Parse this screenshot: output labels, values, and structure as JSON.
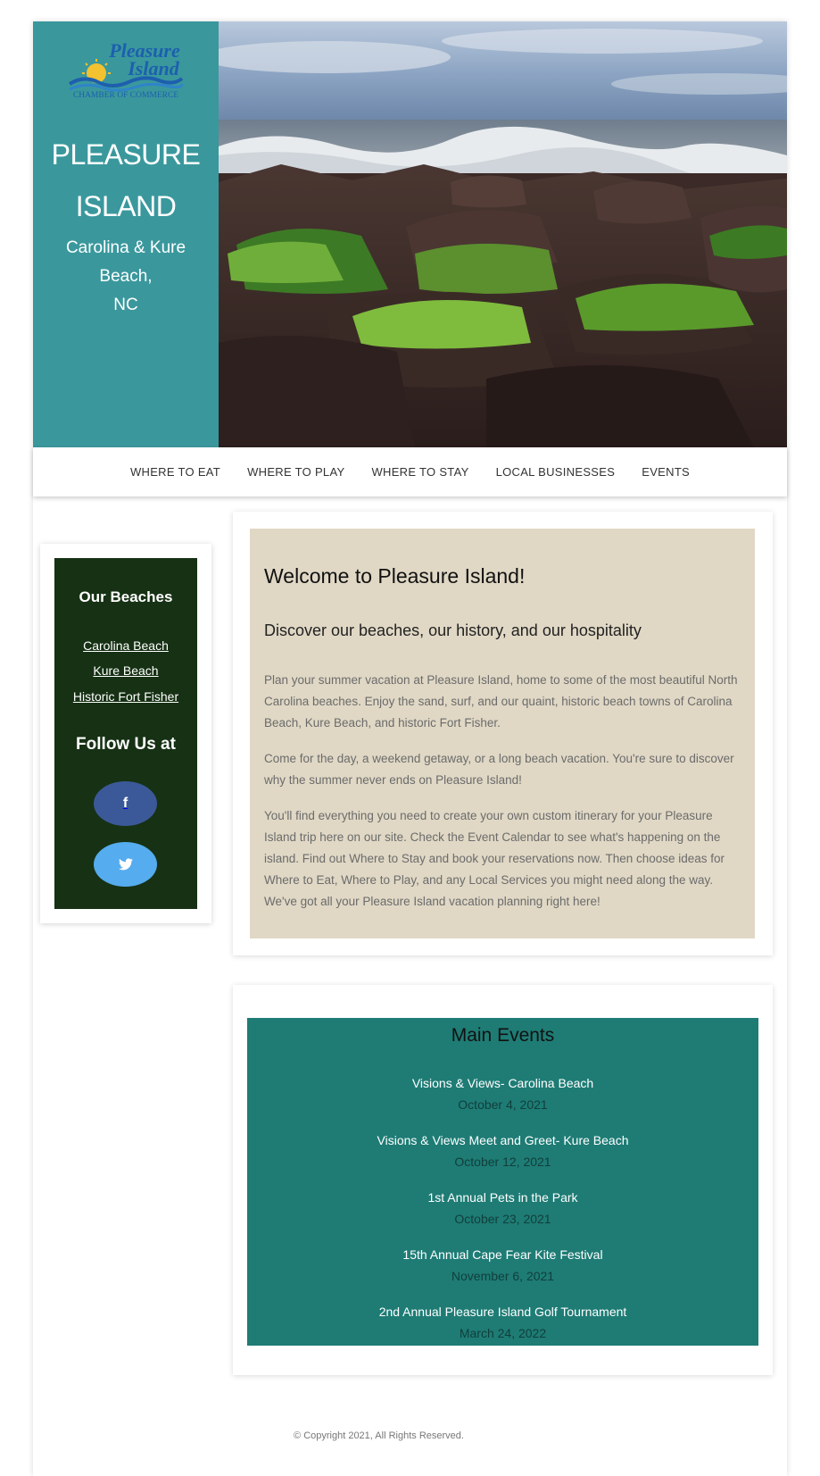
{
  "brand": {
    "logo_text_line1": "Pleasure",
    "logo_text_line2": "Island",
    "logo_tagline": "CHAMBER OF COMMERCE",
    "title_line1": "PLEASURE",
    "title_line2": "ISLAND",
    "subtitle_line1": "Carolina & Kure Beach,",
    "subtitle_line2": "NC",
    "color": "#3a989d"
  },
  "nav": {
    "items": [
      {
        "label": "WHERE TO EAT"
      },
      {
        "label": "WHERE TO PLAY"
      },
      {
        "label": "WHERE TO STAY"
      },
      {
        "label": "LOCAL BUSINESSES"
      },
      {
        "label": "EVENTS"
      }
    ]
  },
  "sidebar": {
    "beaches_heading": "Our Beaches",
    "links": [
      {
        "label": "Carolina Beach"
      },
      {
        "label": "Kure Beach"
      },
      {
        "label": "Historic Fort Fisher"
      }
    ],
    "follow_heading": "Follow Us at",
    "social": [
      {
        "icon": "facebook-icon",
        "glyph": "f",
        "color": "#3b5998"
      },
      {
        "icon": "twitter-icon",
        "color": "#55acee"
      }
    ],
    "bg_color": "#163114"
  },
  "welcome": {
    "title": "Welcome to Pleasure Island!",
    "subtitle": "Discover our beaches, our history, and our hospitality",
    "paragraphs": [
      "Plan your summer vacation at Pleasure Island, home to some of the most beautiful North Carolina beaches. Enjoy the sand, surf, and our quaint, historic beach towns of Carolina Beach, Kure Beach, and historic Fort Fisher.",
      "Come for the day, a weekend getaway, or a long beach vacation. You're sure to discover why the summer never ends on Pleasure Island!",
      "You'll find everything you need to create your own custom itinerary for your Pleasure Island trip here on our site. Check the Event Calendar to see what's happening on the island. Find out Where to Stay and book your reservations now. Then choose ideas for Where to Eat, Where to Play, and any Local Services you might need along the way. We've got all your Pleasure Island vacation planning right here!"
    ],
    "bg_color": "#e0d8c5"
  },
  "events": {
    "title": "Main Events",
    "items": [
      {
        "name": "Visions & Views- Carolina Beach",
        "date": "October 4, 2021"
      },
      {
        "name": "Visions & Views Meet and Greet- Kure Beach",
        "date": "October 12, 2021"
      },
      {
        "name": "1st Annual Pets in the Park",
        "date": "October 23, 2021"
      },
      {
        "name": "15th Annual Cape Fear Kite Festival",
        "date": "November 6, 2021"
      },
      {
        "name": "2nd Annual Pleasure Island Golf Tournament",
        "date": "March 24, 2022"
      }
    ],
    "bg_color": "#1e7c75"
  },
  "footer": {
    "copyright": "© Copyright 2021, All Rights Reserved."
  }
}
